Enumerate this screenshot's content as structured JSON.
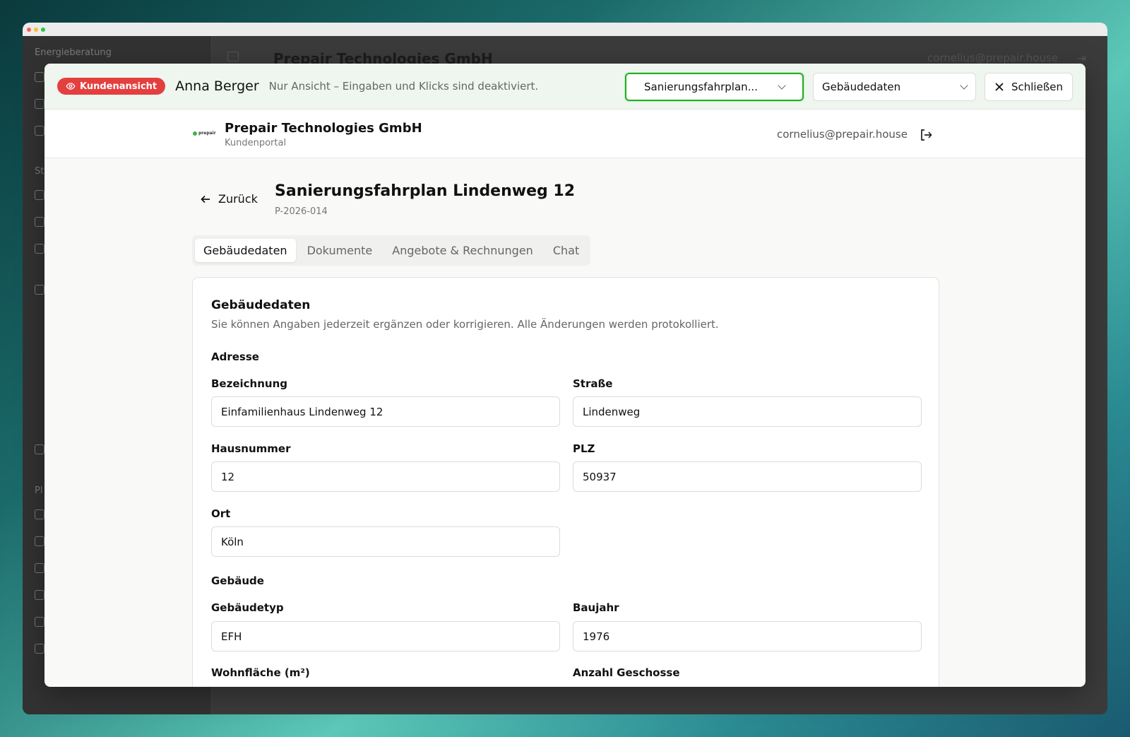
{
  "background_app": {
    "sidebar_section_1": "Energieberatung",
    "sidebar_section_2": "St",
    "sidebar_section_3": "Pl",
    "header_title": "Prepair Technologies GmbH",
    "header_email": "cornelius@prepair.house"
  },
  "overlay_bar": {
    "badge_label": "Kundenansicht",
    "customer_name": "Anna Berger",
    "notice": "Nur Ansicht – Eingaben und Klicks sind deaktiviert.",
    "project_select": "Sanierungsfahrplan...",
    "page_select": "Gebäudedaten",
    "close_label": "Schließen",
    "accent_color": "#22b022",
    "badge_color": "#e43f3f"
  },
  "portal": {
    "logo_text": "prepair",
    "company": "Prepair Technologies GmbH",
    "subtitle": "Kundenportal",
    "email": "cornelius@prepair.house"
  },
  "page": {
    "back_label": "Zurück",
    "title": "Sanierungsfahrplan Lindenweg 12",
    "project_id": "P-2026-014",
    "tabs": [
      "Gebäudedaten",
      "Dokumente",
      "Angebote & Rechnungen",
      "Chat"
    ]
  },
  "form": {
    "title": "Gebäudedaten",
    "description": "Sie können Angaben jederzeit ergänzen oder korrigieren. Alle Änderungen werden protokolliert.",
    "section_address": "Adresse",
    "section_building": "Gebäude",
    "fields": {
      "bezeichnung": {
        "label": "Bezeichnung",
        "value": "Einfamilienhaus Lindenweg 12"
      },
      "strasse": {
        "label": "Straße",
        "value": "Lindenweg"
      },
      "hausnummer": {
        "label": "Hausnummer",
        "value": "12"
      },
      "plz": {
        "label": "PLZ",
        "value": "50937"
      },
      "ort": {
        "label": "Ort",
        "value": "Köln"
      },
      "gebaeudetyp": {
        "label": "Gebäudetyp",
        "value": "EFH"
      },
      "baujahr": {
        "label": "Baujahr",
        "value": "1976"
      },
      "wohnflaeche": {
        "label": "Wohnfläche (m²)"
      },
      "geschosse": {
        "label": "Anzahl Geschosse"
      }
    }
  }
}
